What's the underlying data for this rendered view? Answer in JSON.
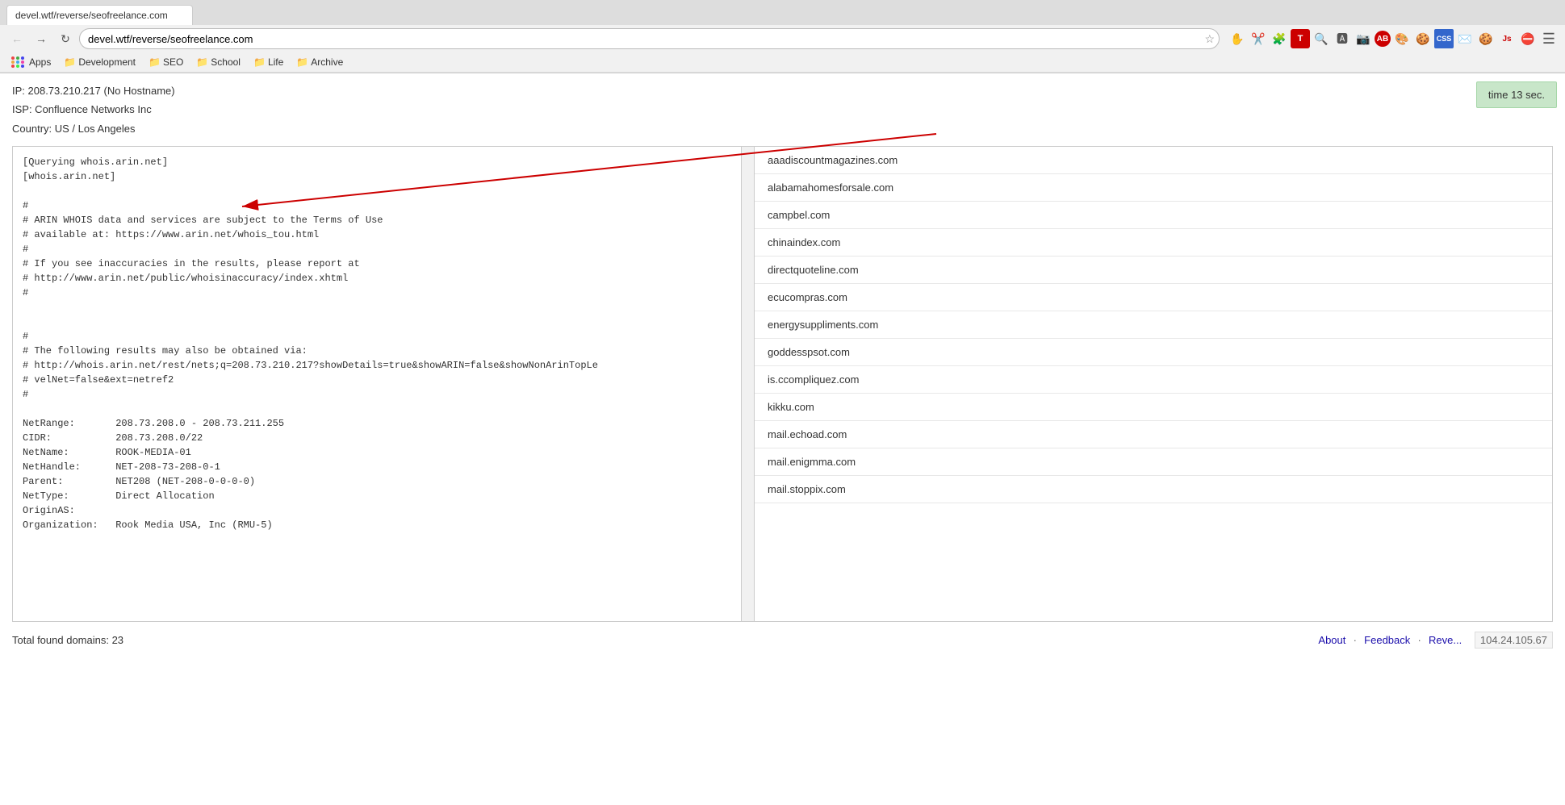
{
  "browser": {
    "url": "devel.wtf/reverse/seofreelance.com",
    "tab_title": "devel.wtf/reverse/seofreelance.com"
  },
  "bookmarks": {
    "apps_label": "Apps",
    "items": [
      {
        "label": "Development",
        "icon": "📁"
      },
      {
        "label": "SEO",
        "icon": "📁"
      },
      {
        "label": "School",
        "icon": "📁"
      },
      {
        "label": "Life",
        "icon": "📁"
      },
      {
        "label": "Archive",
        "icon": "📁"
      }
    ]
  },
  "ip_info": {
    "ip_line": "IP: 208.73.210.217 (No Hostname)",
    "isp_line": "ISP: Confluence Networks Inc",
    "country_line": "Country: US / Los Angeles"
  },
  "time_badge": "time 13 sec.",
  "whois_text": "[Querying whois.arin.net]\n[whois.arin.net]\n\n#\n# ARIN WHOIS data and services are subject to the Terms of Use\n# available at: https://www.arin.net/whois_tou.html\n#\n# If you see inaccuracies in the results, please report at\n# http://www.arin.net/public/whoisinaccuracy/index.xhtml\n#\n\n\n#\n# The following results may also be obtained via:\n# http://whois.arin.net/rest/nets;q=208.73.210.217?showDetails=true&showARIN=false&showNonArinTopLe\n# velNet=false&ext=netref2\n#\n\nNetRange:       208.73.208.0 - 208.73.211.255\nCIDR:           208.73.208.0/22\nNetName:        ROOK-MEDIA-01\nNetHandle:      NET-208-73-208-0-1\nParent:         NET208 (NET-208-0-0-0-0)\nNetType:        Direct Allocation\nOriginAS:\nOrganization:   Rook Media USA, Inc (RMU-5)",
  "domains": [
    "aaadiscountmagazines.com",
    "alabamahomesforsale.com",
    "campbel.com",
    "chinaindex.com",
    "directquoteline.com",
    "ecucompras.com",
    "energysuppliments.com",
    "goddesspsot.com",
    "is.ccompliquez.com",
    "kikku.com",
    "mail.echoad.com",
    "mail.enigmma.com",
    "mail.stoppix.com"
  ],
  "footer": {
    "total_found": "Total found domains: 23",
    "about_label": "About",
    "feedback_label": "Feedback",
    "rev_label": "Reve...",
    "ip_display": "104.24.105.67"
  }
}
